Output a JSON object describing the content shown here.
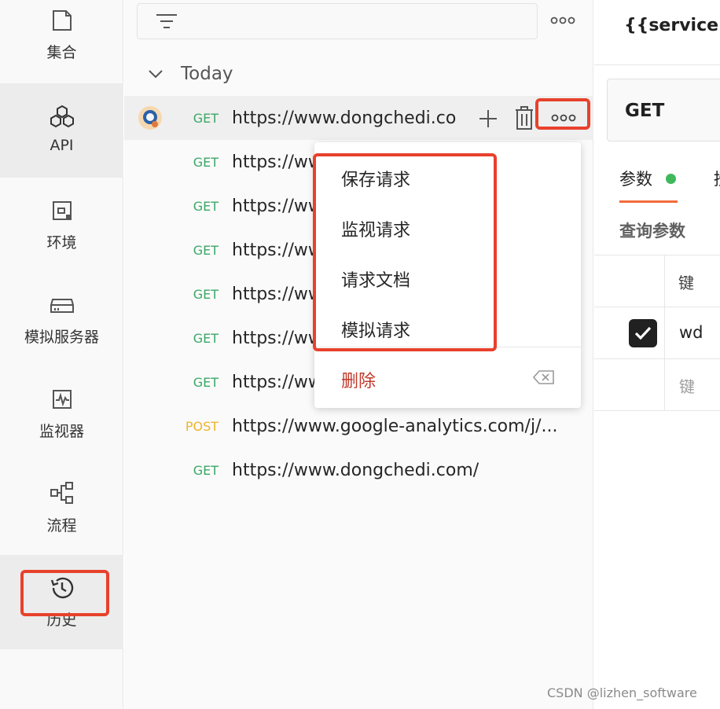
{
  "sidebar": {
    "items": [
      {
        "label": "集合",
        "icon": "collection-icon"
      },
      {
        "label": "API",
        "icon": "api-icon"
      },
      {
        "label": "环境",
        "icon": "environment-icon"
      },
      {
        "label": "模拟服务器",
        "icon": "mock-server-icon"
      },
      {
        "label": "监视器",
        "icon": "monitor-icon"
      },
      {
        "label": "流程",
        "icon": "flow-icon"
      },
      {
        "label": "历史",
        "icon": "history-icon"
      }
    ],
    "active": "API"
  },
  "history": {
    "group_title": "Today",
    "requests": [
      {
        "method": "GET",
        "url": "https://www.dongchedi.co"
      },
      {
        "method": "GET",
        "url": "https://ww"
      },
      {
        "method": "GET",
        "url": "https://ww"
      },
      {
        "method": "GET",
        "url": "https://ww"
      },
      {
        "method": "GET",
        "url": "https://ww"
      },
      {
        "method": "GET",
        "url": "https://ww"
      },
      {
        "method": "GET",
        "url": "https://ww"
      },
      {
        "method": "POST",
        "url": "https://www.google-analytics.com/j/..."
      },
      {
        "method": "GET",
        "url": "https://www.dongchedi.com/"
      }
    ]
  },
  "menu": {
    "items": [
      "保存请求",
      "监视请求",
      "请求文档",
      "模拟请求"
    ],
    "delete_label": "删除"
  },
  "request": {
    "title": "{{serviceU",
    "method": "GET",
    "tab_params": "参数",
    "tab_next": "授",
    "query_title": "查询参数",
    "col_key": "键",
    "row1_key": "wd",
    "row2_placeholder": "键"
  },
  "watermark": "CSDN @lizhen_software",
  "colors": {
    "accent": "#f26b3a",
    "get": "#3aa867",
    "post": "#f0b429",
    "annotation": "#e8412c",
    "delete": "#c0392b"
  }
}
